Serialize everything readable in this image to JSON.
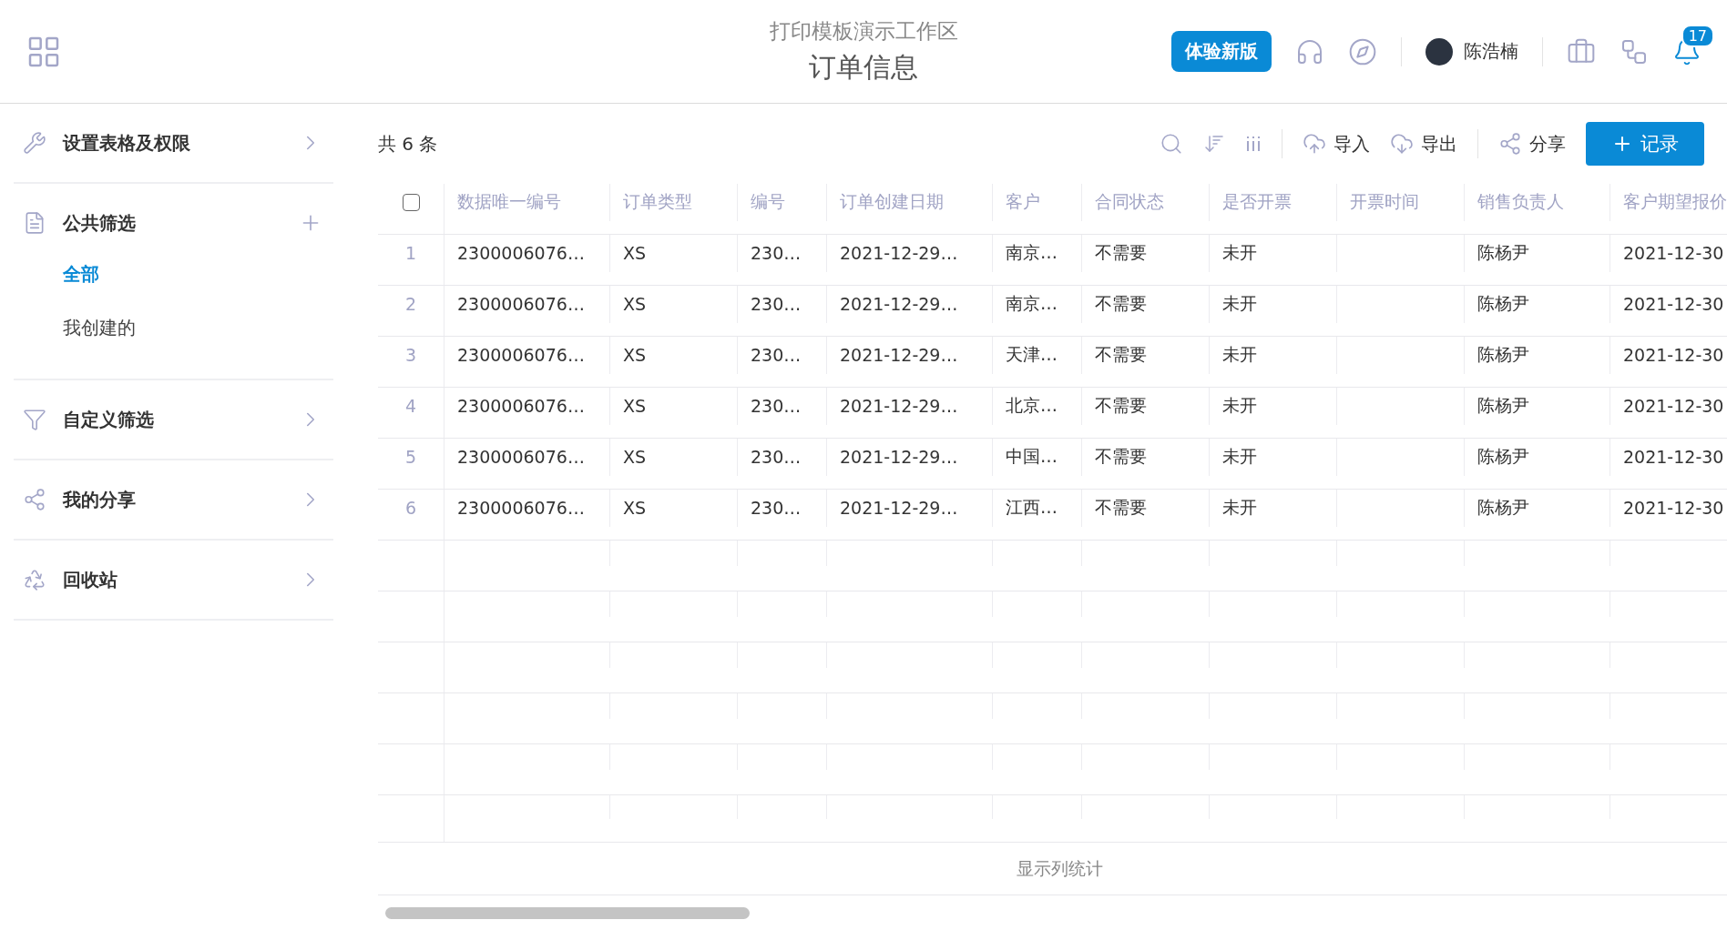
{
  "header": {
    "workspace": "打印模板演示工作区",
    "title": "订单信息",
    "new_version_button": "体验新版",
    "user_name": "陈浩楠",
    "notification_count": "17"
  },
  "sidebar": {
    "sections": [
      {
        "label": "设置表格及权限",
        "kind": "link"
      },
      {
        "label": "公共筛选",
        "kind": "addable",
        "children": [
          {
            "label": "全部",
            "selected": true
          },
          {
            "label": "我创建的",
            "selected": false
          }
        ]
      },
      {
        "label": "自定义筛选",
        "kind": "link"
      },
      {
        "label": "我的分享",
        "kind": "link"
      },
      {
        "label": "回收站",
        "kind": "link"
      }
    ]
  },
  "toolbar": {
    "count": "共 6 条",
    "import": "导入",
    "export": "导出",
    "share": "分享",
    "add_button": "记录"
  },
  "table": {
    "header_checked": false,
    "columns": [
      "数据唯一编号",
      "订单类型",
      "编号",
      "订单创建日期",
      "客户",
      "合同状态",
      "是否开票",
      "开票时间",
      "销售负责人",
      "客户期望报价"
    ],
    "rows": [
      {
        "number": "1",
        "cells": [
          "2300006076…",
          "XS",
          "230…",
          "2021-12-29…",
          "南京…",
          "不需要",
          "未开",
          "",
          "陈杨尹",
          "2021-12-30"
        ]
      },
      {
        "number": "2",
        "cells": [
          "2300006076…",
          "XS",
          "230…",
          "2021-12-29…",
          "南京…",
          "不需要",
          "未开",
          "",
          "陈杨尹",
          "2021-12-30"
        ]
      },
      {
        "number": "3",
        "cells": [
          "2300006076…",
          "XS",
          "230…",
          "2021-12-29…",
          "天津…",
          "不需要",
          "未开",
          "",
          "陈杨尹",
          "2021-12-30"
        ]
      },
      {
        "number": "4",
        "cells": [
          "2300006076…",
          "XS",
          "230…",
          "2021-12-29…",
          "北京…",
          "不需要",
          "未开",
          "",
          "陈杨尹",
          "2021-12-30"
        ]
      },
      {
        "number": "5",
        "cells": [
          "2300006076…",
          "XS",
          "230…",
          "2021-12-29…",
          "中国…",
          "不需要",
          "未开",
          "",
          "陈杨尹",
          "2021-12-30"
        ]
      },
      {
        "number": "6",
        "cells": [
          "2300006076…",
          "XS",
          "230…",
          "2021-12-29…",
          "江西…",
          "不需要",
          "未开",
          "",
          "陈杨尹",
          "2021-12-30"
        ]
      }
    ]
  },
  "footer": {
    "stats_link": "显示列统计"
  }
}
